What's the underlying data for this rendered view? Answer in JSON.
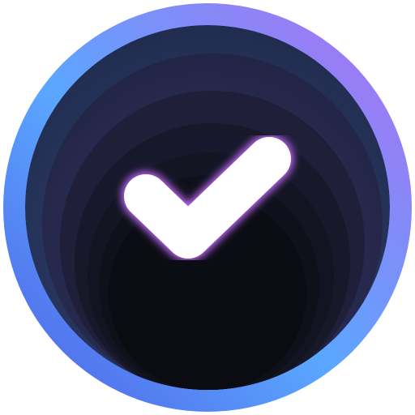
{
  "app_icon": {
    "icon_name": "checkmark-icon",
    "colors": {
      "ring_gradient": [
        "#a66cf0",
        "#5aa7ff",
        "#5566e8"
      ],
      "tunnel_layers": [
        "#2b3b68",
        "#2a2d55",
        "#22223f",
        "#1a1a2f",
        "#141624",
        "#0f121c",
        "#0b0d14"
      ],
      "check_fill": "#ffffff",
      "check_glow": "#c66bff"
    }
  }
}
